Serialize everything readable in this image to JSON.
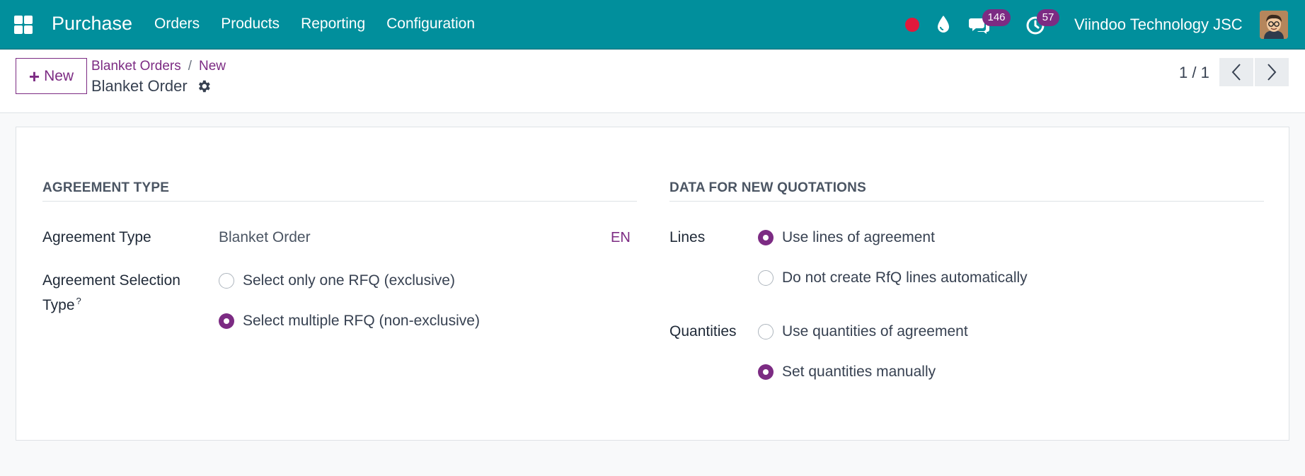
{
  "navbar": {
    "app_title": "Purchase",
    "menu": [
      "Orders",
      "Products",
      "Reporting",
      "Configuration"
    ],
    "messages_count": "146",
    "activities_count": "57",
    "company": "Viindoo Technology JSC",
    "accent_color": "#018f9c",
    "badge_color": "#7c2b83"
  },
  "control": {
    "new_label": "New",
    "breadcrumb": {
      "parent": "Blanket Orders",
      "separator": "/",
      "current": "New"
    },
    "record_title": "Blanket Order",
    "pager": "1 / 1"
  },
  "form": {
    "left": {
      "section_title": "AGREEMENT TYPE",
      "agreement_type_label": "Agreement Type",
      "agreement_type_value": "Blanket Order",
      "lang": "EN",
      "selection_label_line1": "Agreement Selection",
      "selection_label_line2": "Type",
      "selection_help": "?",
      "selection_options": [
        {
          "label": "Select only one RFQ (exclusive)",
          "selected": false
        },
        {
          "label": "Select multiple RFQ (non-exclusive)",
          "selected": true
        }
      ]
    },
    "right": {
      "section_title": "DATA FOR NEW QUOTATIONS",
      "lines_label": "Lines",
      "lines_options": [
        {
          "label": "Use lines of agreement",
          "selected": true
        },
        {
          "label": "Do not create RfQ lines automatically",
          "selected": false
        }
      ],
      "quantities_label": "Quantities",
      "quantities_options": [
        {
          "label": "Use quantities of agreement",
          "selected": false
        },
        {
          "label": "Set quantities manually",
          "selected": true
        }
      ]
    }
  }
}
